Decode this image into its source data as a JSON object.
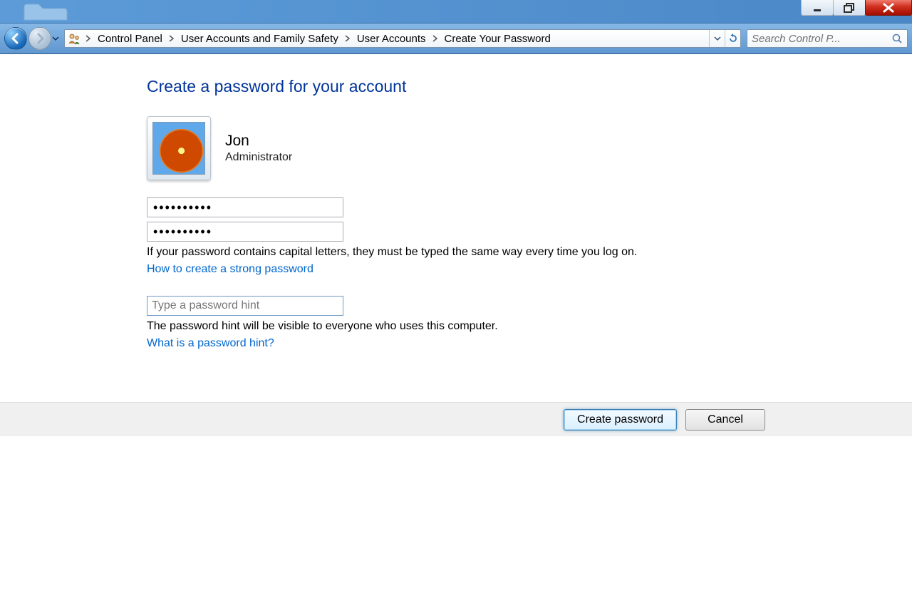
{
  "breadcrumb": {
    "items": [
      "Control Panel",
      "User Accounts and Family Safety",
      "User Accounts",
      "Create Your Password"
    ]
  },
  "search": {
    "placeholder": "Search Control P..."
  },
  "page": {
    "heading": "Create a password for your account",
    "user": {
      "name": "Jon",
      "role": "Administrator"
    },
    "password_value": "••••••••••",
    "password_confirm_value": "••••••••••",
    "caps_note": "If your password contains capital letters, they must be typed the same way every time you log on.",
    "strong_pw_link": "How to create a strong password",
    "hint_placeholder": "Type a password hint",
    "hint_note": "The password hint will be visible to everyone who uses this computer.",
    "hint_help_link": "What is a password hint?"
  },
  "buttons": {
    "create": "Create password",
    "cancel": "Cancel"
  }
}
